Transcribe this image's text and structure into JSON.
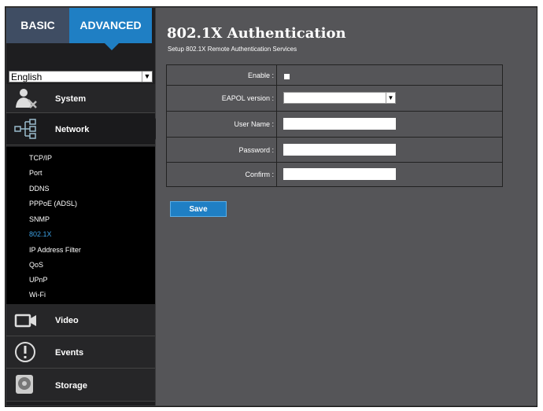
{
  "tabs": {
    "basic": "BASIC",
    "advanced": "ADVANCED"
  },
  "language": {
    "selected": "English"
  },
  "nav": {
    "system": "System",
    "network": "Network",
    "network_items": [
      "TCP/IP",
      "Port",
      "DDNS",
      "PPPoE (ADSL)",
      "SNMP",
      "802.1X",
      "IP Address Filter",
      "QoS",
      "UPnP",
      "Wi-Fi"
    ],
    "active_item": "802.1X",
    "video": "Video",
    "events": "Events",
    "storage": "Storage"
  },
  "page": {
    "title": "802.1X Authentication",
    "subtitle": "Setup 802.1X Remote Authentication Services"
  },
  "form": {
    "enable_label": "Enable :",
    "enable_checked": false,
    "eapol_label": "EAPOL version :",
    "eapol_value": "",
    "username_label": "User Name :",
    "username_value": "",
    "password_label": "Password :",
    "password_value": "",
    "confirm_label": "Confirm :",
    "confirm_value": ""
  },
  "save_label": "Save",
  "colors": {
    "accent": "#1f7fc4",
    "active_link": "#3da1e4",
    "panel": "#555558"
  }
}
